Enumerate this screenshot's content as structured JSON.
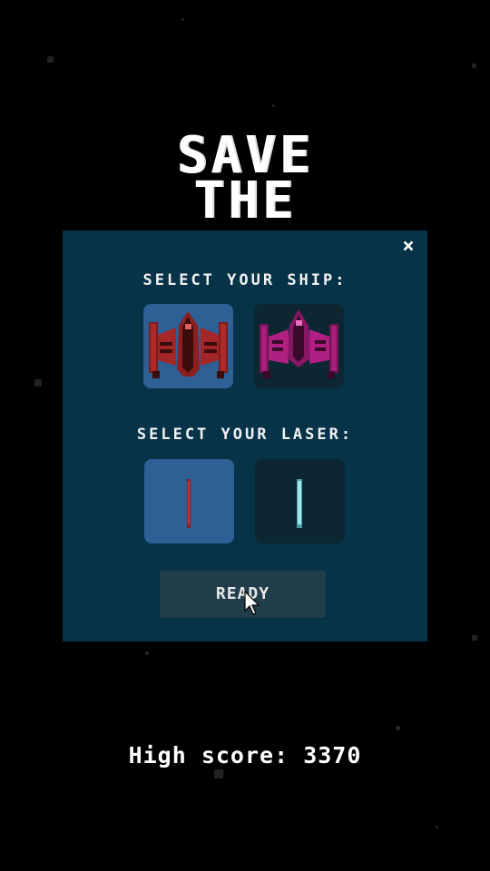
{
  "title": {
    "line1": "SAVE",
    "line2": "THE"
  },
  "dialog": {
    "close_symbol": "×",
    "ship_heading": "SELECT YOUR SHIP:",
    "laser_heading": "SELECT YOUR LASER:",
    "ships": [
      {
        "name": "red-ship",
        "selected": true,
        "color": "#a42626"
      },
      {
        "name": "magenta-ship",
        "selected": false,
        "color": "#b01f82"
      }
    ],
    "lasers": [
      {
        "name": "red-laser",
        "selected": true,
        "color": "#c23b3b"
      },
      {
        "name": "cyan-laser",
        "selected": false,
        "color": "#9fe7ee"
      }
    ],
    "ready_label": "READY"
  },
  "high_score": "High score: 3370",
  "colors": {
    "background": "#000000",
    "panel": "#063347",
    "selected_tile": "#2e5f95",
    "unselected_tile": "#0c2732",
    "button": "#203d49"
  }
}
